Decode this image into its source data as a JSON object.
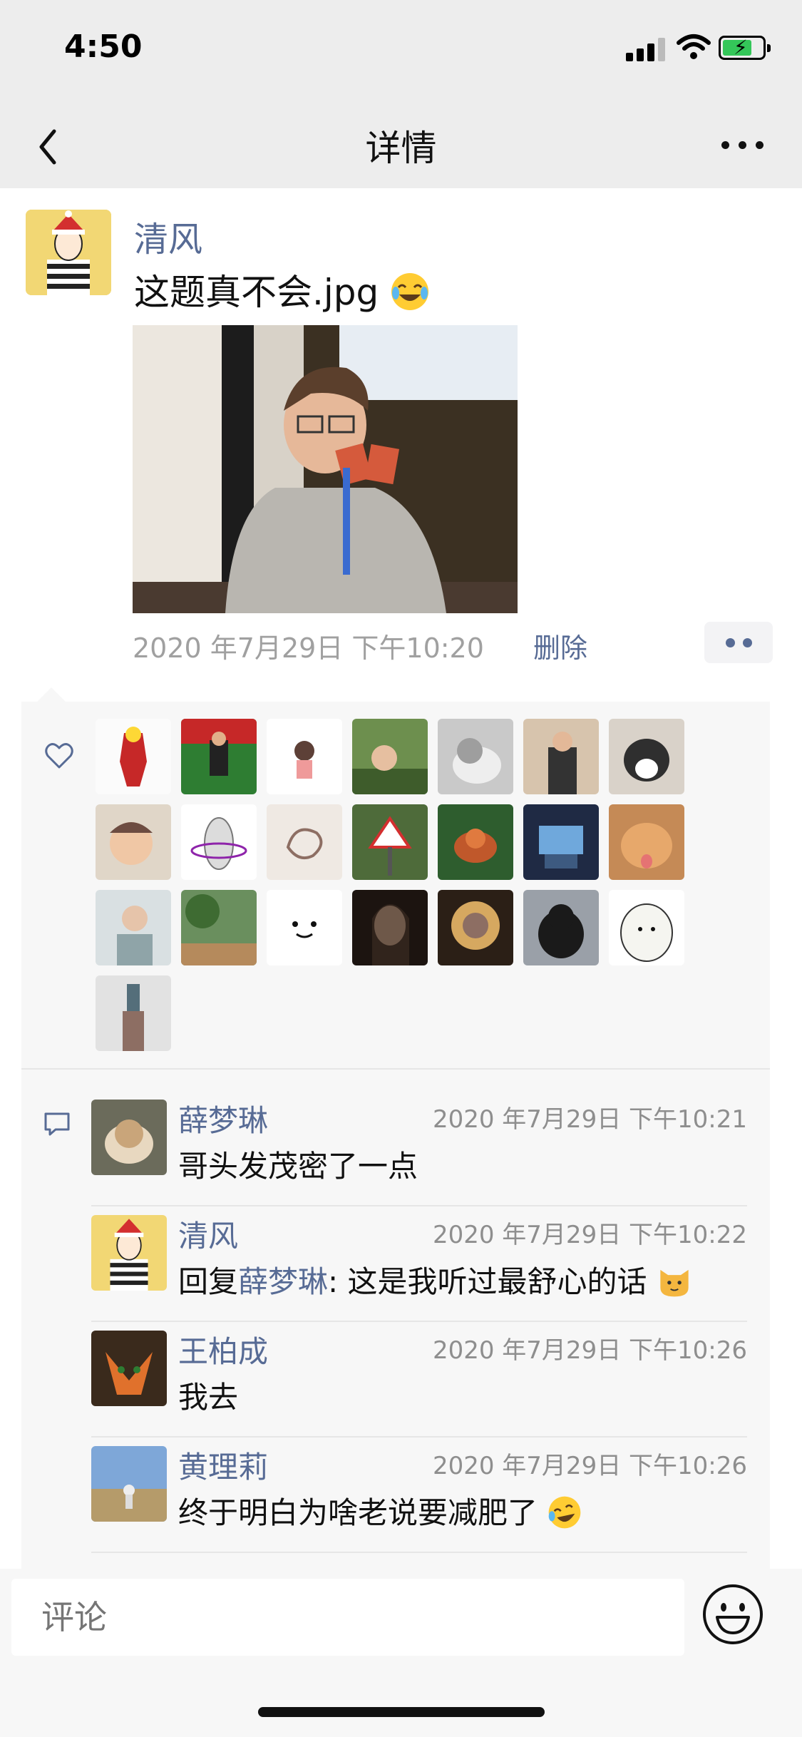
{
  "status_bar": {
    "time": "4:50"
  },
  "nav": {
    "title": "详情"
  },
  "post": {
    "author": "清风",
    "text": "这题真不会.jpg",
    "timestamp": "2020 年7月29日 下午10:20",
    "delete_label": "删除"
  },
  "likes": {
    "count": 22
  },
  "comments": [
    {
      "name": "薛梦琳",
      "time": "2020 年7月29日 下午10:21",
      "text": "哥头发茂密了一点"
    },
    {
      "name": "清风",
      "time": "2020 年7月29日 下午10:22",
      "reply_prefix": "回复",
      "reply_to": "薛梦琳",
      "reply_text": ": 这是我听过最舒心的话"
    },
    {
      "name": "王柏成",
      "time": "2020 年7月29日 下午10:26",
      "text": "我去"
    },
    {
      "name": "黄理莉",
      "time": "2020 年7月29日 下午10:26",
      "text": "终于明白为啥老说要减肥了"
    }
  ],
  "input": {
    "placeholder": "评论"
  },
  "colors": {
    "link": "#576b95",
    "nav_bg": "#ededed",
    "panel_bg": "#f7f7f7"
  }
}
